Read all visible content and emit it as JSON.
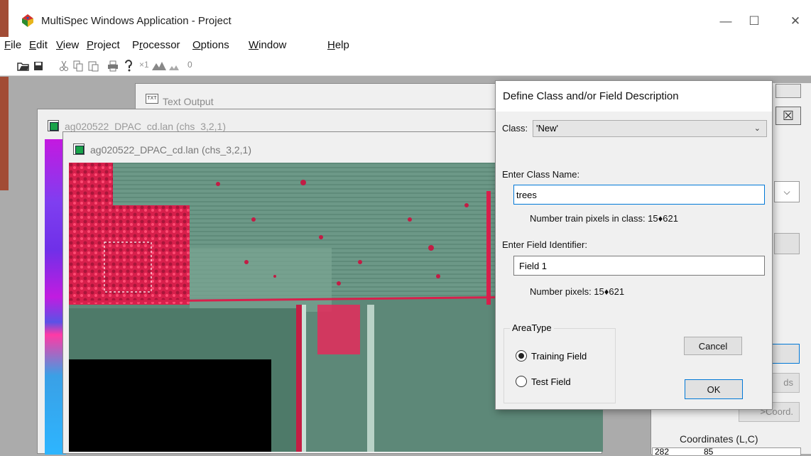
{
  "window": {
    "title": "MultiSpec Windows Application - Project",
    "controls": {
      "minimize": "—",
      "maximize": "☐",
      "close": "✕"
    }
  },
  "menu": [
    {
      "pre": "",
      "ul": "F",
      "post": "ile"
    },
    {
      "pre": "",
      "ul": "E",
      "post": "dit"
    },
    {
      "pre": "",
      "ul": "V",
      "post": "iew"
    },
    {
      "pre": "",
      "ul": "P",
      "post": "roject"
    },
    {
      "pre": "P",
      "ul": "r",
      "post": "ocessor"
    },
    {
      "pre": "",
      "ul": "O",
      "post": "ptions"
    },
    {
      "pre": "",
      "ul": "W",
      "post": "indow"
    },
    {
      "pre": "",
      "ul": "H",
      "post": "elp"
    }
  ],
  "toolbar": {
    "zoom_label": "×1",
    "overlay_label": "0"
  },
  "windows": {
    "text_output_title": "Text Output",
    "image_window_1_title": "ag020522_DPAC_cd.lan (chs_3,2,1)",
    "image_window_2_title": "ag020522_DPAC_cd.lan (chs_3,2,1)"
  },
  "side_panel": {
    "close_glyph": "☒",
    "dropdown_glyph": "⌵",
    "fields_button": "ds",
    "coord_button": ">Coord.",
    "coordinates_label": "Coordinates (L,C)",
    "coord_line": "282",
    "coord_col": "85"
  },
  "dialog": {
    "title": "Define Class and/or Field Description",
    "class_label": "Class:",
    "class_value": "'New'",
    "class_name_label": "Enter Class Name:",
    "class_name_value": "trees",
    "class_pixels_text": "Number train pixels in class: 15♦621",
    "field_id_label": "Enter Field Identifier:",
    "field_id_value": "Field 1",
    "field_pixels_text": "Number pixels: 15♦621",
    "area_type_label": "AreaType",
    "training_field_label": "Training Field",
    "test_field_label": "Test Field",
    "area_type_selected": "Training Field",
    "cancel_label": "Cancel",
    "ok_label": "OK"
  },
  "colors": {
    "accent_edge": "#a24c35",
    "focus_blue": "#0078d7",
    "dialog_bg": "#f0f0f0"
  }
}
